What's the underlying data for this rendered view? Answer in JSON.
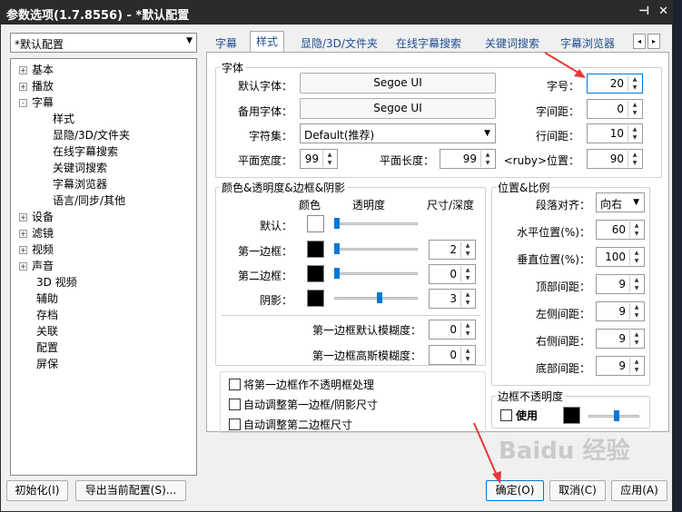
{
  "window": {
    "title": "参数选项(1.7.8556) - *默认配置",
    "pin_icon": "pin-icon",
    "close_icon": "close-icon"
  },
  "profile_select": {
    "value": "*默认配置"
  },
  "tree": [
    {
      "label": "基本",
      "level": 0,
      "expander": "+"
    },
    {
      "label": "播放",
      "level": 0,
      "expander": "+"
    },
    {
      "label": "字幕",
      "level": 0,
      "expander": "-"
    },
    {
      "label": "样式",
      "level": 1
    },
    {
      "label": "显隐/3D/文件夹",
      "level": 1
    },
    {
      "label": "在线字幕搜索",
      "level": 1
    },
    {
      "label": "关键词搜索",
      "level": 1
    },
    {
      "label": "字幕浏览器",
      "level": 1
    },
    {
      "label": "语言/同步/其他",
      "level": 1
    },
    {
      "label": "设备",
      "level": 0,
      "expander": "+"
    },
    {
      "label": "滤镜",
      "level": 0,
      "expander": "+"
    },
    {
      "label": "视频",
      "level": 0,
      "expander": "+"
    },
    {
      "label": "声音",
      "level": 0,
      "expander": "+"
    },
    {
      "label": "3D 视频",
      "level": 0
    },
    {
      "label": "辅助",
      "level": 0
    },
    {
      "label": "存档",
      "level": 0
    },
    {
      "label": "关联",
      "level": 0
    },
    {
      "label": "配置",
      "level": 0
    },
    {
      "label": "屏保",
      "level": 0
    }
  ],
  "tabs": [
    "字幕",
    "样式",
    "显隐/3D/文件夹",
    "在线字幕搜索",
    "关键词搜索",
    "字幕浏览器"
  ],
  "tab_scroll": {
    "left": "◂",
    "right": "▸"
  },
  "font_group": {
    "legend": "字体",
    "default_font_label": "默认字体：",
    "default_font": "Segoe UI",
    "backup_font_label": "备用字体：",
    "backup_font": "Segoe UI",
    "charset_label": "字符集：",
    "charset": "Default(推荐)",
    "flat_width_label": "平面宽度：",
    "flat_width": "99",
    "flat_length_label": "平面长度：",
    "flat_length": "99",
    "size_label": "字号：",
    "size": "20",
    "char_spacing_label": "字间距：",
    "char_spacing": "0",
    "line_spacing_label": "行间距：",
    "line_spacing": "10",
    "ruby_label": "<ruby>位置：",
    "ruby": "90"
  },
  "color_group": {
    "legend": "颜色&透明度&边框&阴影",
    "col_color": "颜色",
    "col_opacity": "透明度",
    "col_size": "尺寸/深度",
    "rows": [
      {
        "label": "默认：",
        "color": "#ffffff",
        "opacity": 0.0,
        "size": null
      },
      {
        "label": "第一边框：",
        "color": "#000000",
        "opacity": 0.0,
        "size": "2"
      },
      {
        "label": "第二边框：",
        "color": "#000000",
        "opacity": 0.0,
        "size": "0"
      },
      {
        "label": "阴影：",
        "color": "#000000",
        "opacity": 0.55,
        "size": "3"
      }
    ],
    "blur1_label": "第一边框默认模糊度：",
    "blur1": "0",
    "blur2_label": "第一边框高斯模糊度：",
    "blur2": "0"
  },
  "checkboxes": [
    {
      "label": "将第一边框作不透明框处理",
      "checked": false
    },
    {
      "label": "自动调整第一边框/阴影尺寸",
      "checked": false
    },
    {
      "label": "自动调整第二边框尺寸",
      "checked": false
    }
  ],
  "position_group": {
    "legend": "位置&比例",
    "align_label": "段落对齐：",
    "align": "向右",
    "hpos_label": "水平位置(%)：",
    "hpos": "60",
    "vpos_label": "垂直位置(%)：",
    "vpos": "100",
    "top_label": "顶部间距：",
    "top": "9",
    "left_label": "左侧间距：",
    "left": "9",
    "right_label": "右侧间距：",
    "right": "9",
    "bottom_label": "底部间距：",
    "bottom": "9"
  },
  "border_opacity": {
    "legend": "边框不透明度",
    "use_label": "使用",
    "use_checked": false,
    "color": "#000000",
    "level": 0.55
  },
  "buttons": {
    "init": "初始化(I)",
    "export": "导出当前配置(S)...",
    "ok": "确定(O)",
    "cancel": "取消(C)",
    "apply": "应用(A)"
  },
  "colors": {
    "accent": "#0078d7",
    "annotation": "#e53935",
    "titlebar": "#2b2b2b"
  },
  "watermark": "Baidu 经验"
}
